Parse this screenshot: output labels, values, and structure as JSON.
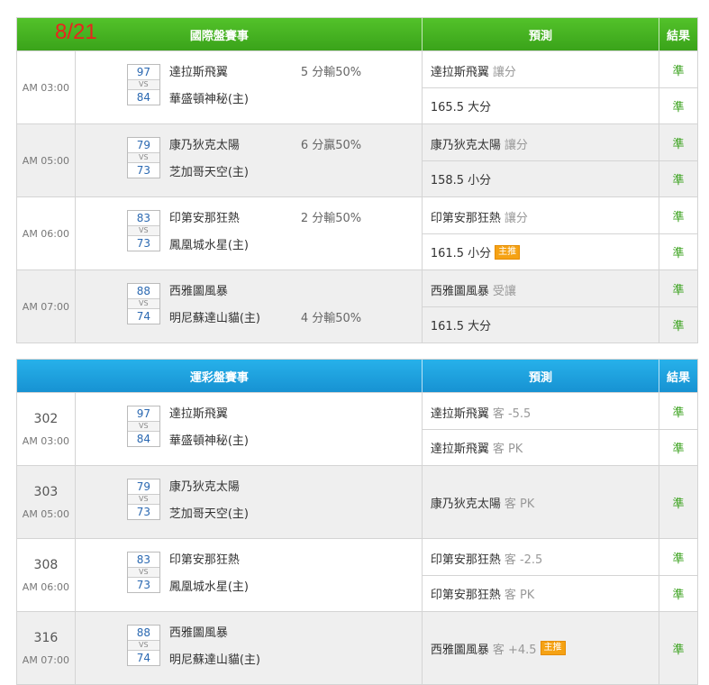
{
  "table1": {
    "date": "8/21",
    "header": {
      "events": "國際盤賽事",
      "prediction": "預測",
      "result": "結果"
    },
    "games": [
      {
        "time": "AM 03:00",
        "away_score": "97",
        "home_score": "84",
        "vs": "VS",
        "away": "達拉斯飛翼",
        "home": "華盛頓神秘(主)",
        "spread": "5 分輸50%",
        "spread_row": "away",
        "predictions": [
          {
            "main": "達拉斯飛翼",
            "extra": "讓分",
            "badge": ""
          },
          {
            "main": "165.5 大分",
            "extra": "",
            "badge": ""
          }
        ],
        "results": [
          "準",
          "準"
        ]
      },
      {
        "time": "AM 05:00",
        "away_score": "79",
        "home_score": "73",
        "vs": "VS",
        "away": "康乃狄克太陽",
        "home": "芝加哥天空(主)",
        "spread": "6 分贏50%",
        "spread_row": "away",
        "predictions": [
          {
            "main": "康乃狄克太陽",
            "extra": "讓分",
            "badge": ""
          },
          {
            "main": "158.5 小分",
            "extra": "",
            "badge": ""
          }
        ],
        "results": [
          "準",
          "準"
        ]
      },
      {
        "time": "AM 06:00",
        "away_score": "83",
        "home_score": "73",
        "vs": "VS",
        "away": "印第安那狂熱",
        "home": "鳳凰城水星(主)",
        "spread": "2 分輸50%",
        "spread_row": "away",
        "predictions": [
          {
            "main": "印第安那狂熱",
            "extra": "讓分",
            "badge": ""
          },
          {
            "main": "161.5 小分",
            "extra": "",
            "badge": "主推"
          }
        ],
        "results": [
          "準",
          "準"
        ]
      },
      {
        "time": "AM 07:00",
        "away_score": "88",
        "home_score": "74",
        "vs": "VS",
        "away": "西雅圖風暴",
        "home": "明尼蘇達山貓(主)",
        "spread": "4 分輸50%",
        "spread_row": "home",
        "predictions": [
          {
            "main": "西雅圖風暴",
            "extra": "受讓",
            "badge": ""
          },
          {
            "main": "161.5 大分",
            "extra": "",
            "badge": ""
          }
        ],
        "results": [
          "準",
          "準"
        ]
      }
    ]
  },
  "table2": {
    "header": {
      "events": "運彩盤賽事",
      "prediction": "預測",
      "result": "結果"
    },
    "games": [
      {
        "num": "302",
        "time": "AM 03:00",
        "away_score": "97",
        "home_score": "84",
        "vs": "VS",
        "away": "達拉斯飛翼",
        "home": "華盛頓神秘(主)",
        "predictions": [
          {
            "main": "達拉斯飛翼",
            "extra": "客 -5.5",
            "badge": ""
          },
          {
            "main": "達拉斯飛翼",
            "extra": "客 PK",
            "badge": ""
          }
        ],
        "results": [
          "準",
          "準"
        ]
      },
      {
        "num": "303",
        "time": "AM 05:00",
        "away_score": "79",
        "home_score": "73",
        "vs": "VS",
        "away": "康乃狄克太陽",
        "home": "芝加哥天空(主)",
        "predictions": [
          {
            "main": "康乃狄克太陽",
            "extra": "客 PK",
            "badge": ""
          }
        ],
        "results": [
          "準"
        ]
      },
      {
        "num": "308",
        "time": "AM 06:00",
        "away_score": "83",
        "home_score": "73",
        "vs": "VS",
        "away": "印第安那狂熱",
        "home": "鳳凰城水星(主)",
        "predictions": [
          {
            "main": "印第安那狂熱",
            "extra": "客 -2.5",
            "badge": ""
          },
          {
            "main": "印第安那狂熱",
            "extra": "客 PK",
            "badge": ""
          }
        ],
        "results": [
          "準",
          "準"
        ]
      },
      {
        "num": "316",
        "time": "AM 07:00",
        "away_score": "88",
        "home_score": "74",
        "vs": "VS",
        "away": "西雅圖風暴",
        "home": "明尼蘇達山貓(主)",
        "predictions": [
          {
            "main": "西雅圖風暴",
            "extra": "客 +4.5",
            "badge": "主推"
          }
        ],
        "results": [
          "準"
        ]
      }
    ]
  }
}
